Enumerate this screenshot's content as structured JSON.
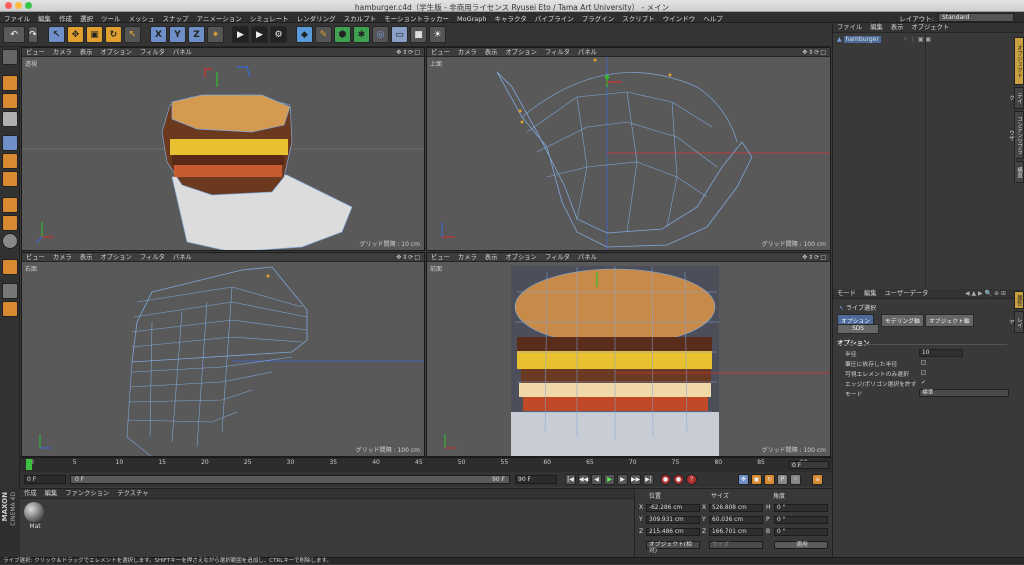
{
  "window": {
    "title": "hamburger.c4d（学生版 - 非商用ライセンス Ryusei Eto / Tama Art University） - メイン"
  },
  "menubar": [
    "ファイル",
    "編集",
    "作成",
    "選択",
    "ツール",
    "メッシュ",
    "スナップ",
    "アニメーション",
    "シミュレート",
    "レンダリング",
    "スカルプト",
    "モーショントラッカー",
    "MoGraph",
    "キャラクタ",
    "パイプライン",
    "プラグイン",
    "スクリプト",
    "ウインドウ",
    "ヘルプ"
  ],
  "layout": {
    "label": "レイアウト:",
    "value": "Standard"
  },
  "viewport_menu": [
    "ビュー",
    "カメラ",
    "表示",
    "オプション",
    "フィルタ",
    "パネル"
  ],
  "viewports": [
    {
      "name": "透視",
      "grid": "グリッド間隔 : 10 cm"
    },
    {
      "name": "上面",
      "grid": "グリッド間隔 : 100 cm"
    },
    {
      "name": "右面",
      "grid": "グリッド間隔 : 100 cm"
    },
    {
      "name": "前面",
      "grid": "グリッド間隔 : 100 cm"
    }
  ],
  "object_manager": {
    "menu": [
      "ファイル",
      "編集",
      "表示",
      "オブジェクト"
    ],
    "object_name": "hamburger"
  },
  "attribute_manager": {
    "menu": [
      "モード",
      "編集",
      "ユーザーデータ"
    ],
    "tool_title": "ライブ選択",
    "tabs": [
      "オプション",
      "モデリング軸",
      "オブジェクト軸",
      "SDS"
    ],
    "section": "オプション",
    "rows": [
      {
        "label": "半径",
        "value": "10"
      },
      {
        "label": "筆圧に依存した半径",
        "value": ""
      },
      {
        "label": "可視エレメントのみ選択",
        "value": ""
      },
      {
        "label": "エッジ/ポリゴン選択を許す",
        "value": "✓"
      },
      {
        "label": "モード",
        "value": "標準"
      }
    ]
  },
  "right_tabs": [
    "オブジェクト",
    "テイク",
    "コンテンツブラウザ",
    "構造"
  ],
  "right_tabs2": [
    "属性",
    "レイヤ"
  ],
  "timeline": {
    "ticks": [
      "0",
      "5",
      "10",
      "15",
      "20",
      "25",
      "30",
      "35",
      "40",
      "45",
      "50",
      "55",
      "60",
      "65",
      "70",
      "75",
      "80",
      "85",
      "90"
    ],
    "current_frame": "0 F",
    "start_field": "0 F",
    "min_field": "0 F",
    "max_field": "90 F",
    "end_field": "90 F"
  },
  "material_manager": {
    "menu": [
      "作成",
      "編集",
      "ファンクション",
      "テクスチャ"
    ],
    "material_name": "Mat"
  },
  "coordinates": {
    "headers": [
      "位置",
      "サイズ",
      "角度"
    ],
    "rows": [
      {
        "axis": "X",
        "pos": "-62.286 cm",
        "size_axis": "X",
        "size": "526.808 cm",
        "rot_axis": "H",
        "rot": "0 °"
      },
      {
        "axis": "Y",
        "pos": "309.931 cm",
        "size_axis": "Y",
        "size": "60.036 cm",
        "rot_axis": "P",
        "rot": "0 °"
      },
      {
        "axis": "Z",
        "pos": "215.486 cm",
        "size_axis": "Z",
        "size": "166.701 cm",
        "rot_axis": "B",
        "rot": "0 °"
      }
    ],
    "mode": "オブジェクト(相対)",
    "size_mode": "サイズ",
    "apply": "適用"
  },
  "brand": {
    "line1": "MAXON",
    "line2": "CINEMA 4D"
  },
  "status": "ライブ選択: クリック＆ドラッグでエレメントを選択します。SHIFTキーを押さえながら選択範囲を追加し、CTRLキーで削除します。",
  "colors": {
    "accent": "#4c6a9a",
    "axis_red": "#d83030",
    "axis_green": "#30c030",
    "axis_blue": "#3a6ad8"
  }
}
